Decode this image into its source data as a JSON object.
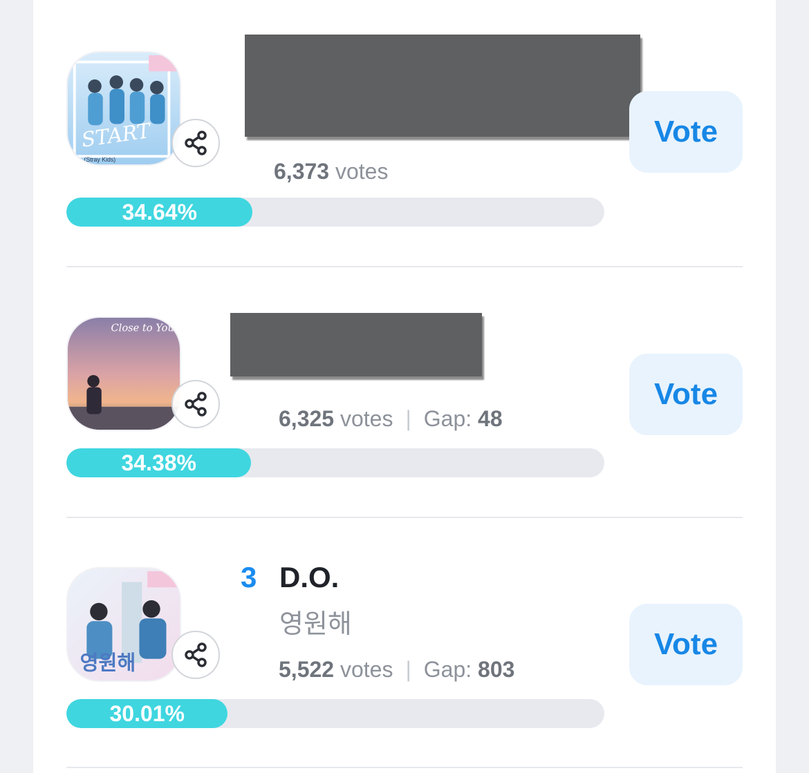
{
  "entries": [
    {
      "rank": "",
      "artist": "",
      "song": "",
      "votes": "6,373",
      "votes_unit": "votes",
      "gap_label": "",
      "gap": "",
      "percent_text": "34.64%",
      "percent": 34.64,
      "vote_label": "Vote",
      "album_art_text": "START",
      "album_art_caption": "(Stray Kids)"
    },
    {
      "rank": "",
      "artist": "",
      "song": "",
      "votes": "6,325",
      "votes_unit": "votes",
      "gap_label": "Gap:",
      "gap": "48",
      "percent_text": "34.38%",
      "percent": 34.38,
      "vote_label": "Vote",
      "album_art_text": "Close to You"
    },
    {
      "rank": "3",
      "artist": "D.O.",
      "song": "영원해",
      "votes": "5,522",
      "votes_unit": "votes",
      "gap_label": "Gap:",
      "gap": "803",
      "percent_text": "30.01%",
      "percent": 30.01,
      "vote_label": "Vote",
      "album_art_text": "영원해"
    }
  ],
  "colors": {
    "accent": "#1a8cf0",
    "bar_fill": "#3fd6e0",
    "bar_track": "#e7e9ee",
    "vote_button_bg": "#e8f3fd",
    "redaction": "#5f6062"
  },
  "icons": {
    "share": "share-icon"
  }
}
